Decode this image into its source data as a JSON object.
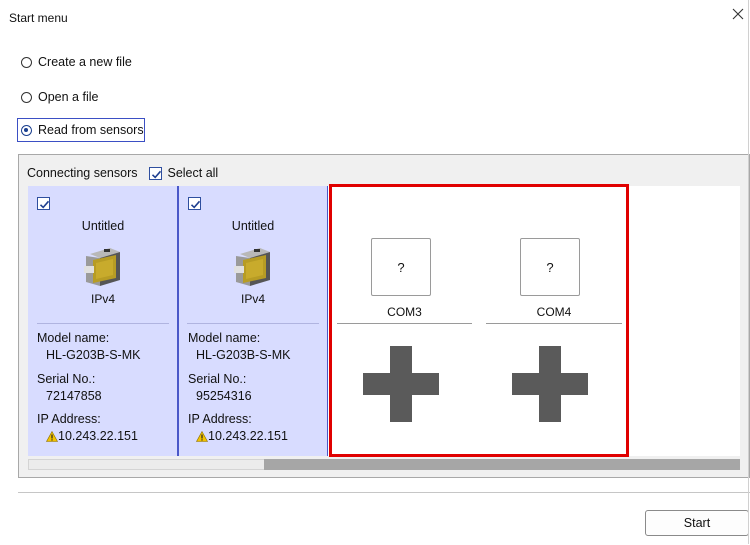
{
  "window": {
    "title": "Start menu",
    "close_icon": "close-icon"
  },
  "options": [
    {
      "label": "Create a new file",
      "selected": false
    },
    {
      "label": "Open a file",
      "selected": false
    },
    {
      "label": "Read from sensors",
      "selected": true
    }
  ],
  "connecting": {
    "label": "Connecting sensors",
    "select_all_label": "Select all",
    "select_all_checked": true
  },
  "sensors": [
    {
      "checked": true,
      "name": "Untitled",
      "protocol": "IPv4",
      "model_label": "Model name:",
      "model": "HL-G203B-S-MK",
      "serial_label": "Serial No.:",
      "serial": "72147858",
      "ip_label": "IP Address:",
      "ip": "10.243.22.151",
      "ip_icon": "warning-icon"
    },
    {
      "checked": true,
      "name": "Untitled",
      "protocol": "IPv4",
      "model_label": "Model name:",
      "model": "HL-G203B-S-MK",
      "serial_label": "Serial No.:",
      "serial": "95254316",
      "ip_label": "IP Address:",
      "ip": "10.243.22.151",
      "ip_icon": "warning-icon"
    }
  ],
  "empty_slots": [
    {
      "unknown_symbol": "?",
      "port": "COM3",
      "add_icon": "plus-icon"
    },
    {
      "unknown_symbol": "?",
      "port": "COM4",
      "add_icon": "plus-icon"
    }
  ],
  "highlight_color": "#e00000",
  "scrollbar": {
    "position_fraction": 0.33
  },
  "footer": {
    "start_label": "Start"
  }
}
